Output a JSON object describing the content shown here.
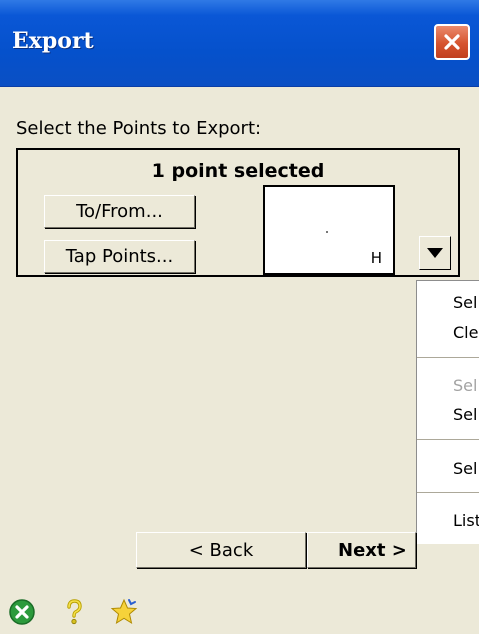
{
  "window": {
    "title": "Export"
  },
  "prompt": "Select the Points to Export:",
  "selection": {
    "count_label": "1 point selected",
    "tofrom_label": "To/From...",
    "tap_points_label": "Tap Points...",
    "preview_letter": "H"
  },
  "menu": {
    "items": [
      {
        "label": "Sel",
        "enabled": true
      },
      {
        "label": "Cle",
        "enabled": true
      },
      {
        "label": "Sel",
        "enabled": false
      },
      {
        "label": "Sel",
        "enabled": true
      },
      {
        "label": "Sel",
        "enabled": true
      },
      {
        "label": "List",
        "enabled": true
      }
    ]
  },
  "footer": {
    "back_label": "< Back",
    "next_label": "Next >"
  },
  "statusbar": {
    "icons": [
      "ok-icon",
      "help-icon",
      "favorites-icon"
    ]
  },
  "colors": {
    "title_bar": "#0551cc",
    "close_button": "#d6542f",
    "background": "#ece9d8"
  }
}
